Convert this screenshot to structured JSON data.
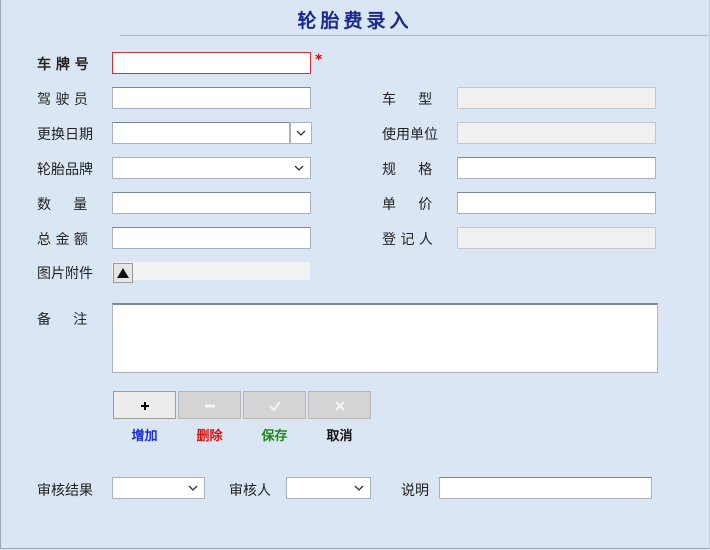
{
  "form": {
    "title": "轮胎费录入",
    "required_mark": "*",
    "fields": {
      "plate": {
        "label": "车 牌 号",
        "value": ""
      },
      "driver": {
        "label": "驾 驶 员",
        "value": ""
      },
      "change_date": {
        "label": "更换日期",
        "value": ""
      },
      "brand": {
        "label": "轮胎品牌",
        "value": ""
      },
      "quantity": {
        "label": "数     量",
        "value": ""
      },
      "total": {
        "label": "总 金 额",
        "value": ""
      },
      "attachment": {
        "label": "图片附件"
      },
      "vehicle_type": {
        "label": "车     型",
        "value": ""
      },
      "unit": {
        "label": "使用单位",
        "value": ""
      },
      "spec": {
        "label": "规     格",
        "value": ""
      },
      "price": {
        "label": "单     价",
        "value": ""
      },
      "registrar": {
        "label": "登 记 人",
        "value": ""
      },
      "remarks": {
        "label": "备     注",
        "value": ""
      }
    }
  },
  "toolbar": {
    "add": {
      "label": "增加",
      "color": "#1c2fcf"
    },
    "delete": {
      "label": "删除",
      "color": "#d01818"
    },
    "save": {
      "label": "保存",
      "color": "#1b8a1b"
    },
    "cancel": {
      "label": "取消",
      "color": "#111111"
    }
  },
  "review": {
    "result_label": "审核结果",
    "result_value": "",
    "reviewer_label": "审核人",
    "reviewer_value": "",
    "note_label": "说明",
    "note_value": ""
  }
}
